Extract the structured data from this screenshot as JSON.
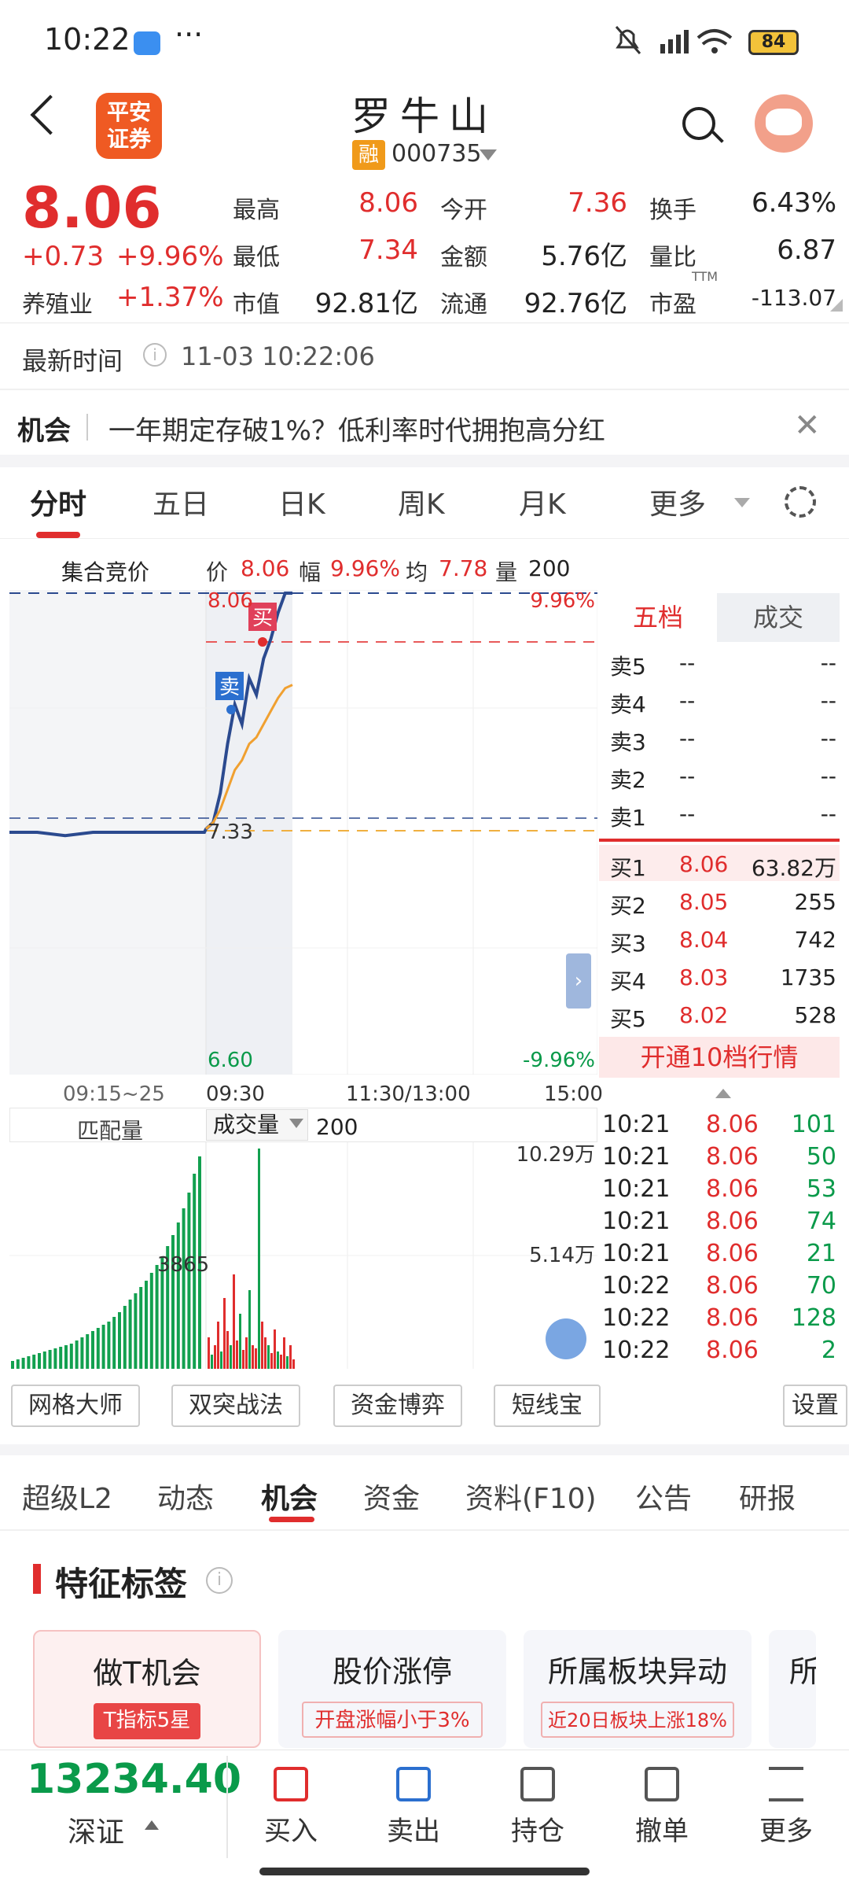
{
  "status_bar": {
    "time": "10:22",
    "dots": "···",
    "battery": "84"
  },
  "header": {
    "logo_line1": "平安",
    "logo_line2": "证券",
    "stock_name": "罗牛山",
    "margin_badge": "融",
    "stock_code": "000735"
  },
  "quote": {
    "price": "8.06",
    "change": "+0.73",
    "change_pct": "+9.96%",
    "sector_name": "养殖业",
    "sector_change": "+1.37%",
    "stats": [
      {
        "label": "最高",
        "value": "8.06",
        "color": "red"
      },
      {
        "label": "今开",
        "value": "7.36",
        "color": "red"
      },
      {
        "label": "换手",
        "value": "6.43%",
        "color": "dark"
      },
      {
        "label": "最低",
        "value": "7.34",
        "color": "red"
      },
      {
        "label": "金额",
        "value": "5.76亿",
        "color": "dark"
      },
      {
        "label": "量比",
        "value": "6.87",
        "color": "dark"
      },
      {
        "label": "市值",
        "value": "92.81亿",
        "color": "dark"
      },
      {
        "label": "流通",
        "value": "92.76亿",
        "color": "dark"
      },
      {
        "label": "市盈",
        "value": "-113.07",
        "color": "dark",
        "sup": "TTM"
      }
    ],
    "update_label": "最新时间",
    "update_time": "11-03 10:22:06"
  },
  "opportunity": {
    "label": "机会",
    "text": "一年期定存破1%？低利率时代拥抱高分红",
    "close": "✕"
  },
  "chart_tabs": [
    "分时",
    "五日",
    "日K",
    "周K",
    "月K",
    "更多"
  ],
  "chart_info": {
    "auction": "集合竞价",
    "price_label": "价",
    "price": "8.06",
    "pct_label": "幅",
    "pct": "9.96%",
    "avg_label": "均",
    "avg": "7.78",
    "vol_label": "量",
    "vol": "200"
  },
  "chart_axis": {
    "top_price": "8.06",
    "top_pct": "9.96%",
    "mid_price": "7.33",
    "bottom_price": "6.60",
    "bottom_pct": "-9.96%",
    "buy_marker": "买",
    "sell_marker": "卖",
    "times": [
      "09:15~25",
      "09:30",
      "11:30/13:00",
      "15:00"
    ]
  },
  "chart_data": {
    "type": "line",
    "title": "",
    "ylim": [
      6.6,
      8.06
    ],
    "prev_close": 7.33,
    "series": [
      {
        "values": [
          7.33,
          7.33,
          7.32,
          7.33,
          7.33,
          7.33,
          7.33,
          7.33,
          7.34,
          7.36,
          7.45,
          7.6,
          7.72,
          7.66,
          7.8,
          7.75,
          7.86,
          7.92,
          8.0,
          8.06,
          8.06
        ]
      },
      {
        "values": [
          7.33,
          7.33,
          7.33,
          7.33,
          7.33,
          7.33,
          7.33,
          7.33,
          7.34,
          7.36,
          7.4,
          7.46,
          7.52,
          7.55,
          7.6,
          7.62,
          7.66,
          7.7,
          7.74,
          7.77,
          7.78
        ]
      }
    ]
  },
  "orderbook": {
    "tab_five": "五档",
    "tab_trades": "成交",
    "asks": [
      {
        "label": "卖5",
        "price": "--",
        "vol": "--"
      },
      {
        "label": "卖4",
        "price": "--",
        "vol": "--"
      },
      {
        "label": "卖3",
        "price": "--",
        "vol": "--"
      },
      {
        "label": "卖2",
        "price": "--",
        "vol": "--"
      },
      {
        "label": "卖1",
        "price": "--",
        "vol": "--"
      }
    ],
    "bids": [
      {
        "label": "买1",
        "price": "8.06",
        "vol": "63.82万"
      },
      {
        "label": "买2",
        "price": "8.05",
        "vol": "255"
      },
      {
        "label": "买3",
        "price": "8.04",
        "vol": "742"
      },
      {
        "label": "买4",
        "price": "8.03",
        "vol": "1735"
      },
      {
        "label": "买5",
        "price": "8.02",
        "vol": "528"
      }
    ],
    "upgrade": "开通10档行情",
    "expand": "›"
  },
  "volume": {
    "match_label": "匹配量",
    "select_value": "成交量",
    "current": "200",
    "axis_top": "10.29万",
    "axis_mid": "5.14万",
    "auction_peak": "3865"
  },
  "trades": [
    {
      "time": "10:21",
      "price": "8.06",
      "vol": "101"
    },
    {
      "time": "10:21",
      "price": "8.06",
      "vol": "50"
    },
    {
      "time": "10:21",
      "price": "8.06",
      "vol": "53"
    },
    {
      "time": "10:21",
      "price": "8.06",
      "vol": "74"
    },
    {
      "time": "10:21",
      "price": "8.06",
      "vol": "21"
    },
    {
      "time": "10:22",
      "price": "8.06",
      "vol": "70"
    },
    {
      "time": "10:22",
      "price": "8.06",
      "vol": "128"
    },
    {
      "time": "10:22",
      "price": "8.06",
      "vol": "2"
    }
  ],
  "tools": [
    "网格大师",
    "双突战法",
    "资金博弈",
    "短线宝",
    "设置"
  ],
  "section_tabs": [
    "超级L2",
    "动态",
    "机会",
    "资金",
    "资料(F10)",
    "公告",
    "研报"
  ],
  "features": {
    "title": "特征标签",
    "cards": [
      {
        "title": "做T机会",
        "tag": "T指标5星"
      },
      {
        "title": "股价涨停",
        "tag": "开盘涨幅小于3%"
      },
      {
        "title": "所属板块异动",
        "tag": "近20日板块上涨18%"
      },
      {
        "title": "所"
      }
    ]
  },
  "bottom": {
    "index_value": "13234.40",
    "index_name": "深证",
    "nav": [
      "买入",
      "卖出",
      "持仓",
      "撤单",
      "更多"
    ]
  },
  "colors": {
    "up": "#e02d2d",
    "down": "#0a9a4a",
    "price_line": "#2b4a8f",
    "avg_line": "#f0a030"
  }
}
